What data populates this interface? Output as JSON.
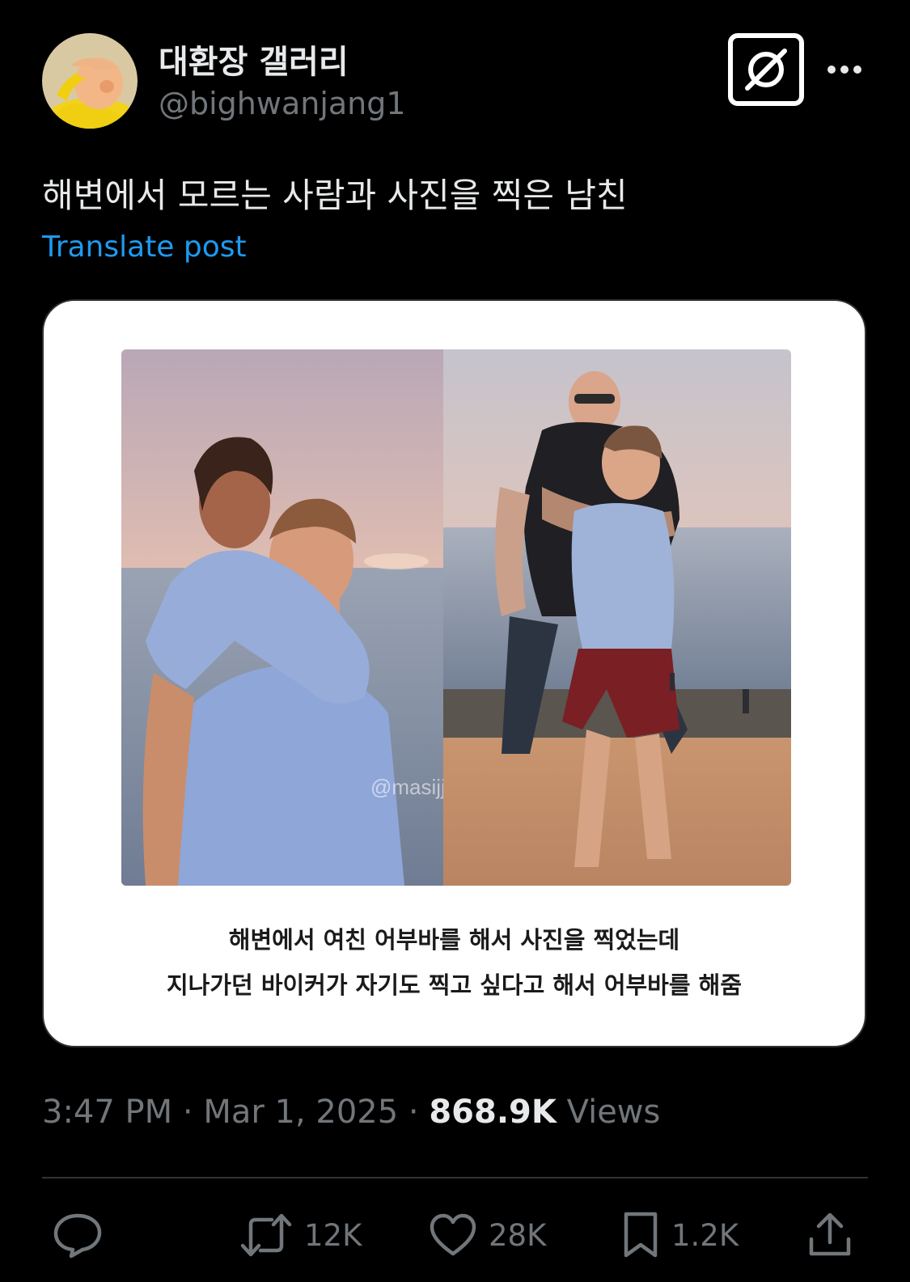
{
  "author": {
    "display_name": "대환장 갤러리",
    "handle": "@bighwanjang1",
    "avatar_icon": "avatar-yellow-character"
  },
  "header": {
    "grok_icon": "grok-icon",
    "more_icon": "more-icon"
  },
  "post": {
    "text": "해변에서 모르는 사람과 사진을 찍은 남친",
    "translate_label": "Translate post",
    "media": {
      "watermark": "@masijjyeong_",
      "caption_line1": "해변에서 여친 어부바를 해서 사진을 찍었는데",
      "caption_line2": "지나가던 바이커가 자기도 찍고 싶다고 해서 어부바를 해줌"
    }
  },
  "meta": {
    "time": "3:47 PM",
    "separator": "·",
    "date": "Mar 1, 2025",
    "views_count": "868.9K",
    "views_label": "Views"
  },
  "actions": {
    "reply": {
      "icon": "reply-icon",
      "count": ""
    },
    "repost": {
      "icon": "repost-icon",
      "count": "12K"
    },
    "like": {
      "icon": "heart-icon",
      "count": "28K"
    },
    "bookmark": {
      "icon": "bookmark-icon",
      "count": "1.2K"
    },
    "share": {
      "icon": "share-icon",
      "count": ""
    }
  },
  "colors": {
    "background": "#000000",
    "text_primary": "#e7e9ea",
    "text_secondary": "#71767b",
    "link": "#1d9bf0",
    "divider": "#2f3336"
  }
}
